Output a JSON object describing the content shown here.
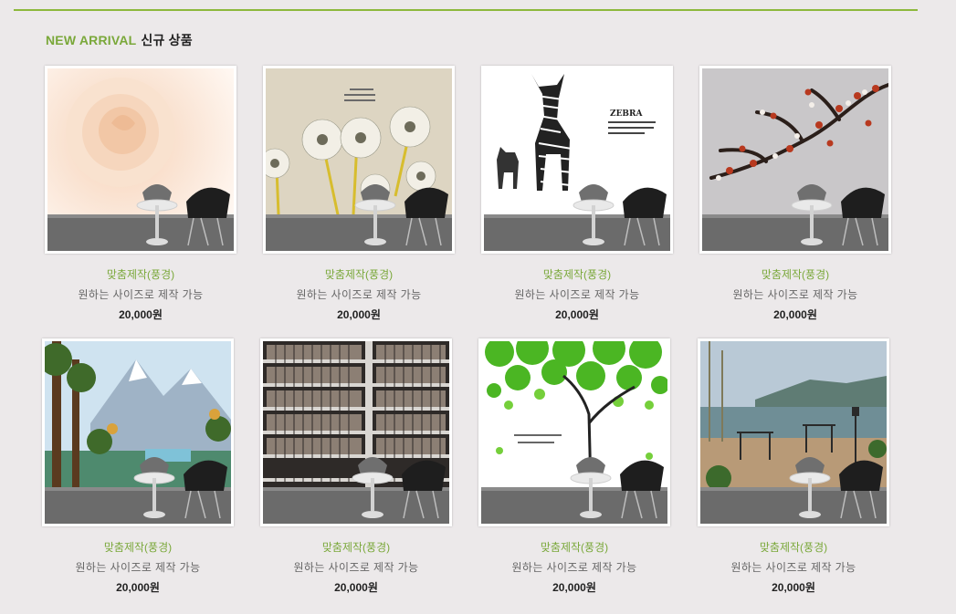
{
  "section": {
    "title_en": "NEW ARRIVAL",
    "title_ko": "신규 상품"
  },
  "products": [
    {
      "name": "맞춤제작(풍경)",
      "desc": "원하는 사이즈로 제작 가능",
      "price": "20,000원",
      "image": "rose-wallpaper"
    },
    {
      "name": "맞춤제작(풍경)",
      "desc": "원하는 사이즈로 제작 가능",
      "price": "20,000원",
      "image": "dandelion-wallpaper"
    },
    {
      "name": "맞춤제작(풍경)",
      "desc": "원하는 사이즈로 제작 가능",
      "price": "20,000원",
      "image": "zebra-wallpaper",
      "image_text": "ZEBRA"
    },
    {
      "name": "맞춤제작(풍경)",
      "desc": "원하는 사이즈로 제작 가능",
      "price": "20,000원",
      "image": "blossom-wallpaper"
    },
    {
      "name": "맞춤제작(풍경)",
      "desc": "원하는 사이즈로 제작 가능",
      "price": "20,000원",
      "image": "mountain-lake-wallpaper"
    },
    {
      "name": "맞춤제작(풍경)",
      "desc": "원하는 사이즈로 제작 가능",
      "price": "20,000원",
      "image": "bookshelf-wallpaper"
    },
    {
      "name": "맞춤제작(풍경)",
      "desc": "원하는 사이즈로 제작 가능",
      "price": "20,000원",
      "image": "green-tree-wallpaper"
    },
    {
      "name": "맞춤제작(풍경)",
      "desc": "원하는 사이즈로 제작 가능",
      "price": "20,000원",
      "image": "terrace-lake-wallpaper"
    }
  ],
  "colors": {
    "accent": "#7aa83a",
    "rule": "#8db83c",
    "background": "#ece9ea"
  }
}
